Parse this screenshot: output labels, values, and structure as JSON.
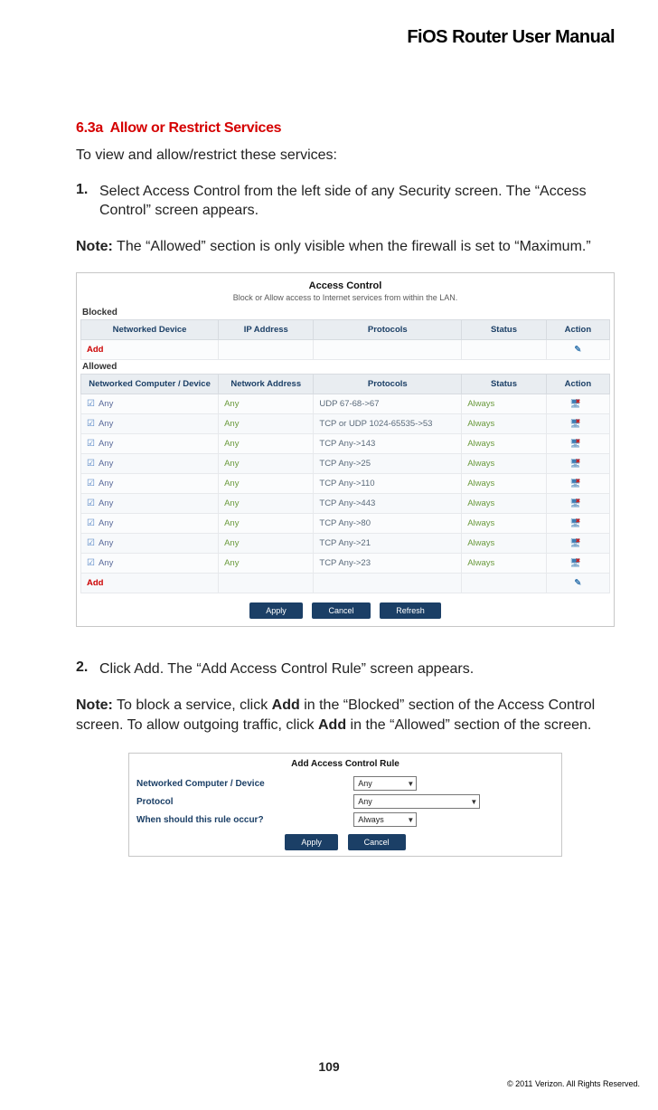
{
  "header": {
    "title": "FiOS Router User Manual"
  },
  "section": {
    "number": "6.3a",
    "title": "Allow or Restrict Services",
    "intro": "To view and allow/restrict these services:",
    "step1": {
      "num": "1.",
      "pre": "Select ",
      "bold": "Access Control",
      "post": " from the left side of any Security screen. The “Access Control” screen appears."
    },
    "note1": {
      "label": "Note:",
      "text": " The “Allowed” section is only visible when the firewall is set to “Maximum.”"
    },
    "step2": {
      "num": "2.",
      "pre": "Click ",
      "bold": "Add",
      "post": ". The “Add Access Control Rule” screen appears."
    },
    "note2": {
      "label": "Note:",
      "p1": " To block a service, click ",
      "b1": "Add",
      "p2": " in the “Blocked” section of the Access Control screen. To allow outgoing traffic, click ",
      "b2": "Add",
      "p3": " in the “Allowed” section of the screen."
    }
  },
  "fig1": {
    "title": "Access Control",
    "subtitle": "Block or Allow access to Internet services from within the LAN.",
    "blocked_label": "Blocked",
    "allowed_label": "Allowed",
    "blocked_headers": [
      "Networked Device",
      "IP Address",
      "Protocols",
      "Status",
      "Action"
    ],
    "allowed_headers": [
      "Networked Computer / Device",
      "Network Address",
      "Protocols",
      "Status",
      "Action"
    ],
    "add_label": "Add",
    "allowed_rows": [
      {
        "dev": "Any",
        "addr": "Any",
        "proto": "UDP 67-68->67",
        "status": "Always"
      },
      {
        "dev": "Any",
        "addr": "Any",
        "proto": "TCP or UDP 1024-65535->53",
        "status": "Always"
      },
      {
        "dev": "Any",
        "addr": "Any",
        "proto": "TCP Any->143",
        "status": "Always"
      },
      {
        "dev": "Any",
        "addr": "Any",
        "proto": "TCP Any->25",
        "status": "Always"
      },
      {
        "dev": "Any",
        "addr": "Any",
        "proto": "TCP Any->110",
        "status": "Always"
      },
      {
        "dev": "Any",
        "addr": "Any",
        "proto": "TCP Any->443",
        "status": "Always"
      },
      {
        "dev": "Any",
        "addr": "Any",
        "proto": "TCP Any->80",
        "status": "Always"
      },
      {
        "dev": "Any",
        "addr": "Any",
        "proto": "TCP Any->21",
        "status": "Always"
      },
      {
        "dev": "Any",
        "addr": "Any",
        "proto": "TCP Any->23",
        "status": "Always"
      }
    ],
    "buttons": {
      "apply": "Apply",
      "cancel": "Cancel",
      "refresh": "Refresh"
    }
  },
  "fig2": {
    "title": "Add Access Control Rule",
    "rows": [
      {
        "label": "Networked Computer / Device",
        "value": "Any",
        "w": "w1"
      },
      {
        "label": "Protocol",
        "value": "Any",
        "w": "w2"
      },
      {
        "label": "When should this rule occur?",
        "value": "Always",
        "w": "w1"
      }
    ],
    "buttons": {
      "apply": "Apply",
      "cancel": "Cancel"
    }
  },
  "footer": {
    "page": "109",
    "copyright": "© 2011 Verizon. All Rights Reserved."
  }
}
